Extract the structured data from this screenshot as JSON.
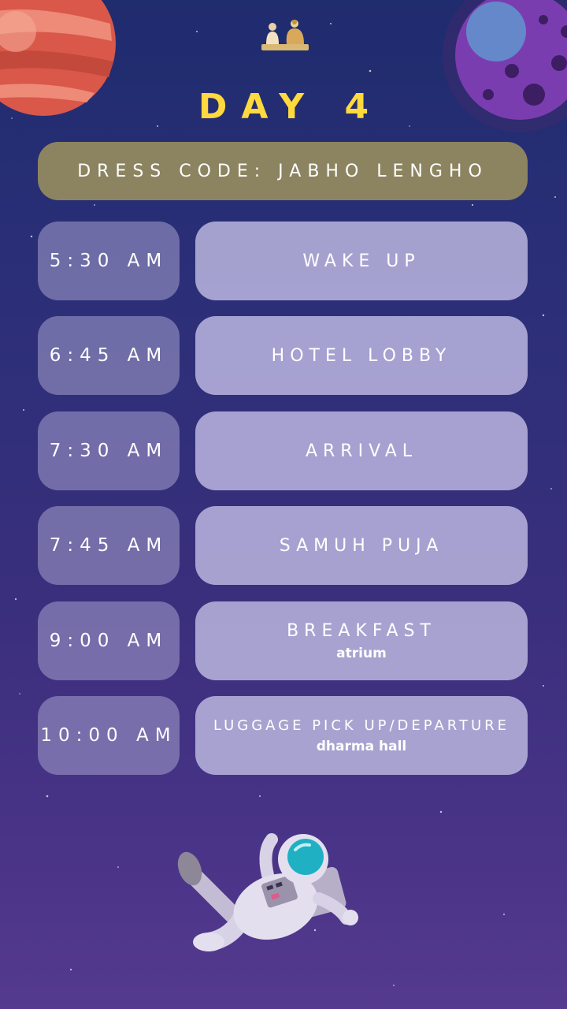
{
  "header": {
    "title": "DAY 4",
    "dress_code": "DRESS CODE: JABHO LENGHO"
  },
  "schedule": [
    {
      "time": "5:30 AM",
      "event": "WAKE UP",
      "note": ""
    },
    {
      "time": "6:45 AM",
      "event": "HOTEL LOBBY",
      "note": ""
    },
    {
      "time": "7:30 AM",
      "event": "ARRIVAL",
      "note": ""
    },
    {
      "time": "7:45 AM",
      "event": "SAMUH PUJA",
      "note": ""
    },
    {
      "time": "9:00 AM",
      "event": "BREAKFAST",
      "note": "atrium"
    },
    {
      "time": "10:00 AM",
      "event": "LUGGAGE PICK UP/DEPARTURE",
      "note": "dharma hall"
    }
  ],
  "decorations": {
    "logo": "figures-logo-icon",
    "planet_left": "red-planet-icon",
    "planet_right": "purple-planet-icon",
    "astronaut": "astronaut-icon"
  },
  "colors": {
    "title": "#ffd93d",
    "dress_bar": "#8c8460",
    "time_box": "#a5a0cd",
    "event_box": "#b6b2dc"
  }
}
